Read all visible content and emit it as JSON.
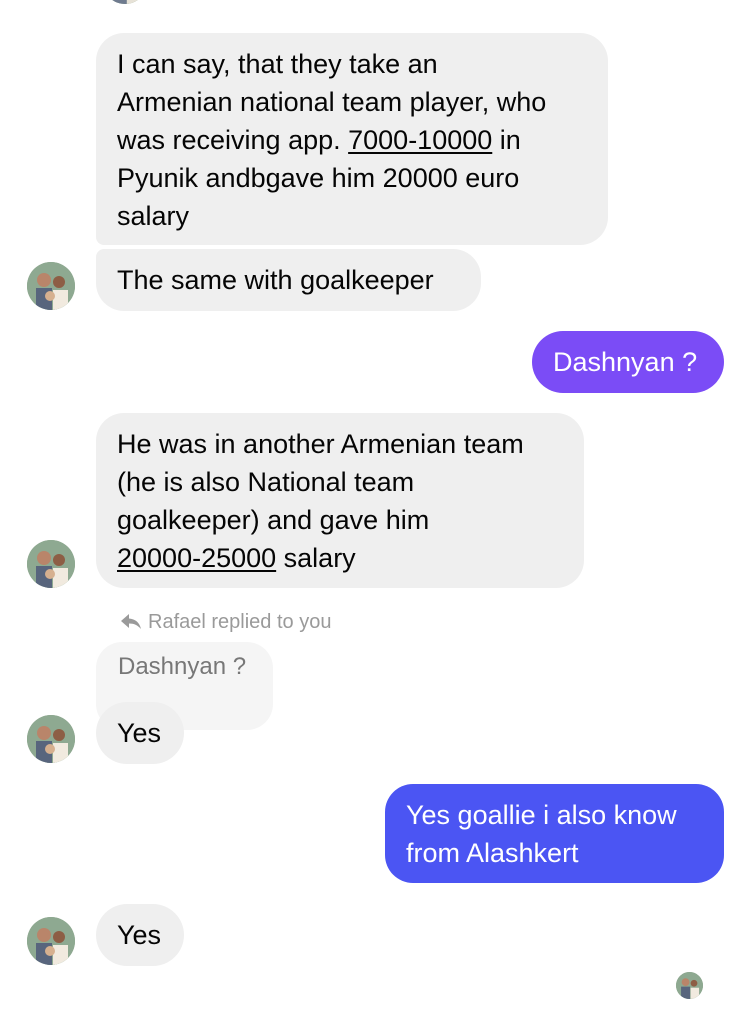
{
  "thread": {
    "messages": [
      {
        "sender": "contact",
        "lines": [
          [
            "I can say, that they take an"
          ],
          [
            "Armenian national team player, who"
          ],
          [
            "was receiving app. ",
            {
              "u": "7000-10000"
            },
            " in"
          ],
          [
            "Pyunik andbgave him 20000 euro"
          ],
          [
            "salary"
          ]
        ]
      },
      {
        "sender": "contact",
        "lines": [
          [
            "The same with goalkeeper"
          ]
        ]
      },
      {
        "sender": "me",
        "lines": [
          [
            "Dashnyan ?"
          ]
        ],
        "color": "#7b4cf6"
      },
      {
        "sender": "contact",
        "lines": [
          [
            "He was in another Armenian team"
          ],
          [
            "(he is also National team"
          ],
          [
            "goalkeeper) and gave him"
          ],
          [
            {
              "u": "20000-25000"
            },
            " salary"
          ]
        ]
      },
      {
        "sender": "contact",
        "lines": [
          [
            "Yes"
          ]
        ],
        "reply_to": "Dashnyan ?"
      },
      {
        "sender": "me",
        "lines": [
          [
            "Yes goallie i also know"
          ],
          [
            "from Alashkert"
          ]
        ],
        "color": "#4b55f3"
      },
      {
        "sender": "contact",
        "lines": [
          [
            "Yes"
          ]
        ]
      }
    ],
    "reply_note": "Rafael replied to you",
    "reply_quote": "Dashnyan ?"
  },
  "colors": {
    "incoming_bubble": "#efefef",
    "outgoing_purple": "#7b4cf6",
    "outgoing_blue": "#4b55f3",
    "meta_text": "#9a9a9a"
  },
  "icons": {
    "reply": "reply-arrow-icon",
    "avatar": "contact-avatar",
    "seen": "seen-avatar"
  }
}
